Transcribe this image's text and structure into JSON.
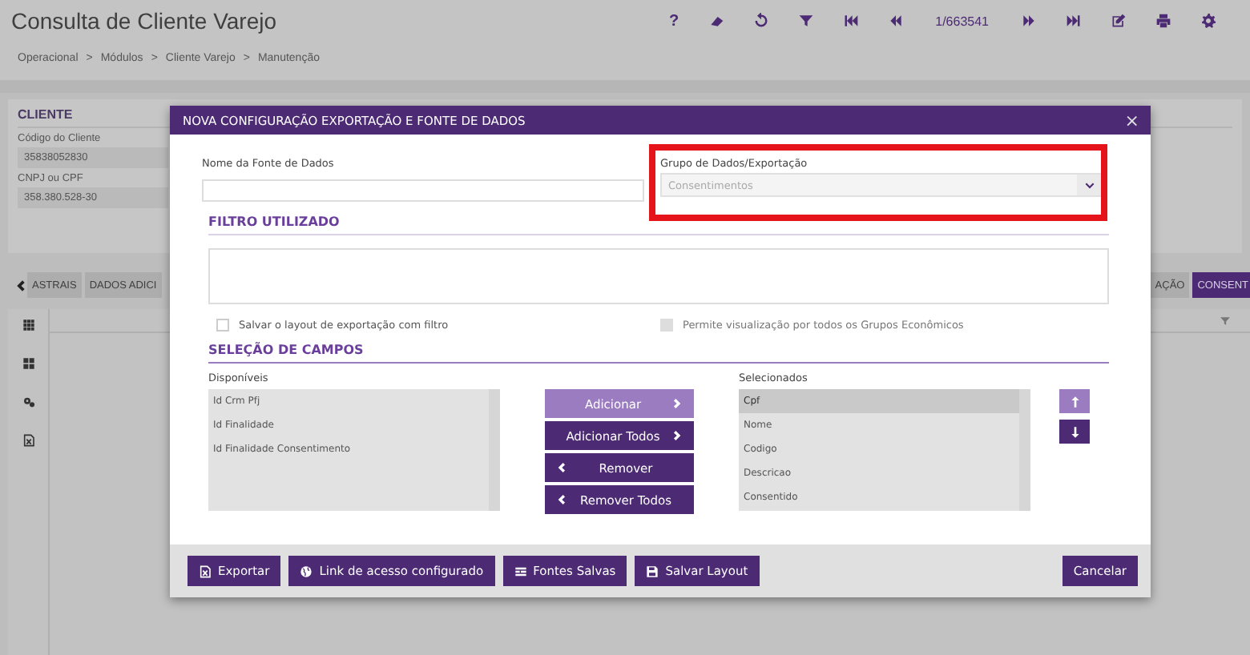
{
  "header": {
    "title": "Consulta de Cliente Varejo",
    "help": "?",
    "record_counter": "1/663541"
  },
  "breadcrumb": {
    "separator": ">",
    "items": [
      "Operacional",
      "Módulos",
      "Cliente Varejo",
      "Manutenção"
    ]
  },
  "client": {
    "title": "CLIENTE",
    "fields": [
      {
        "label": "Código do Cliente",
        "value": "35838052830"
      },
      {
        "label": "CNPJ ou CPF",
        "value": "358.380.528-30"
      }
    ]
  },
  "tabs": [
    {
      "label": "ASTRAIS",
      "selected": false
    },
    {
      "label": "DADOS ADICI",
      "selected": false
    },
    {
      "label": "AÇÃO",
      "selected": false
    },
    {
      "label": "CONSENT",
      "selected": true
    }
  ],
  "modal": {
    "title": "NOVA CONFIGURAÇÃO EXPORTAÇÃO E FONTE DE DADOS",
    "close": "×",
    "name_field": {
      "label": "Nome da Fonte de Dados"
    },
    "group_field": {
      "label": "Grupo de Dados/Exportação",
      "value": "Consentimentos",
      "disabled": true,
      "highlighted": true
    },
    "filter_section": "FILTRO UTILIZADO",
    "options": [
      {
        "label": "Salvar o layout de exportação com filtro",
        "checked": false,
        "disabled": false
      },
      {
        "label": "Permite visualização por todos os Grupos Econômicos",
        "checked": false,
        "disabled": true
      }
    ],
    "fields_section": "SELEÇÃO DE CAMPOS",
    "available": {
      "label": "Disponíveis",
      "items": [
        {
          "label": "Id Crm Pfj",
          "selected": false
        },
        {
          "label": "Id Finalidade",
          "selected": false
        },
        {
          "label": "Id Finalidade Consentimento",
          "selected": false
        }
      ]
    },
    "transfer_buttons": [
      {
        "label": "Adicionar",
        "kind": "add",
        "disabled": true
      },
      {
        "label": "Adicionar Todos",
        "kind": "add",
        "disabled": false
      },
      {
        "label": "Remover",
        "kind": "remove",
        "disabled": false
      },
      {
        "label": "Remover Todos",
        "kind": "remove",
        "disabled": false
      }
    ],
    "chosen": {
      "label": "Selecionados",
      "items": [
        {
          "label": "Cpf",
          "selected": true
        },
        {
          "label": "Nome",
          "selected": false
        },
        {
          "label": "Codigo",
          "selected": false
        },
        {
          "label": "Descricao",
          "selected": false
        },
        {
          "label": "Consentido",
          "selected": false
        }
      ]
    },
    "move_buttons": [
      {
        "kind": "up",
        "disabled": true
      },
      {
        "kind": "down",
        "disabled": false
      }
    ],
    "footer_buttons": [
      {
        "label": "Exportar",
        "kind": "excel"
      },
      {
        "label": "Link de acesso configurado",
        "kind": "globe"
      },
      {
        "label": "Fontes Salvas",
        "kind": "list"
      },
      {
        "label": "Salvar Layout",
        "kind": "save"
      },
      {
        "label": "Cancelar",
        "kind": "plain"
      }
    ]
  }
}
